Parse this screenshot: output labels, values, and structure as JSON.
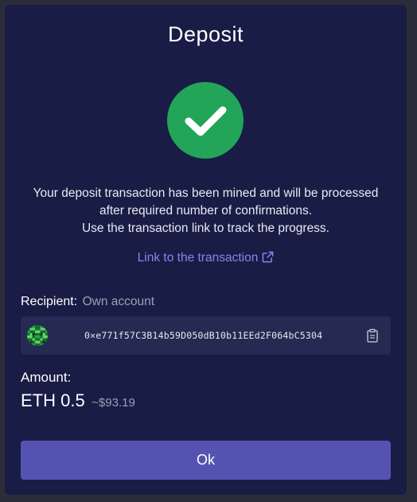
{
  "dialog": {
    "title": "Deposit",
    "status_icon": "checkmark-icon",
    "message_lines": [
      "Your deposit transaction has been mined and will be processed",
      "after required number of confirmations.",
      "Use the transaction link to track the progress."
    ],
    "tx_link_label": "Link to the transaction",
    "tx_link_icon": "external-link-icon"
  },
  "recipient": {
    "label": "Recipient:",
    "value": "Own account",
    "address": "0×e771f57C3B14b59D050dB10b11EEd2F064bC5304",
    "copy_icon": "clipboard-icon"
  },
  "amount": {
    "label": "Amount:",
    "value": "ETH 0.5",
    "fiat": "~$93.19"
  },
  "ok_label": "Ok",
  "colors": {
    "background": "#2a2c3a",
    "dialog": "#191c45",
    "success": "#22a559",
    "link": "#8a84f0",
    "button": "#5553b1",
    "address_box": "#252a52"
  }
}
